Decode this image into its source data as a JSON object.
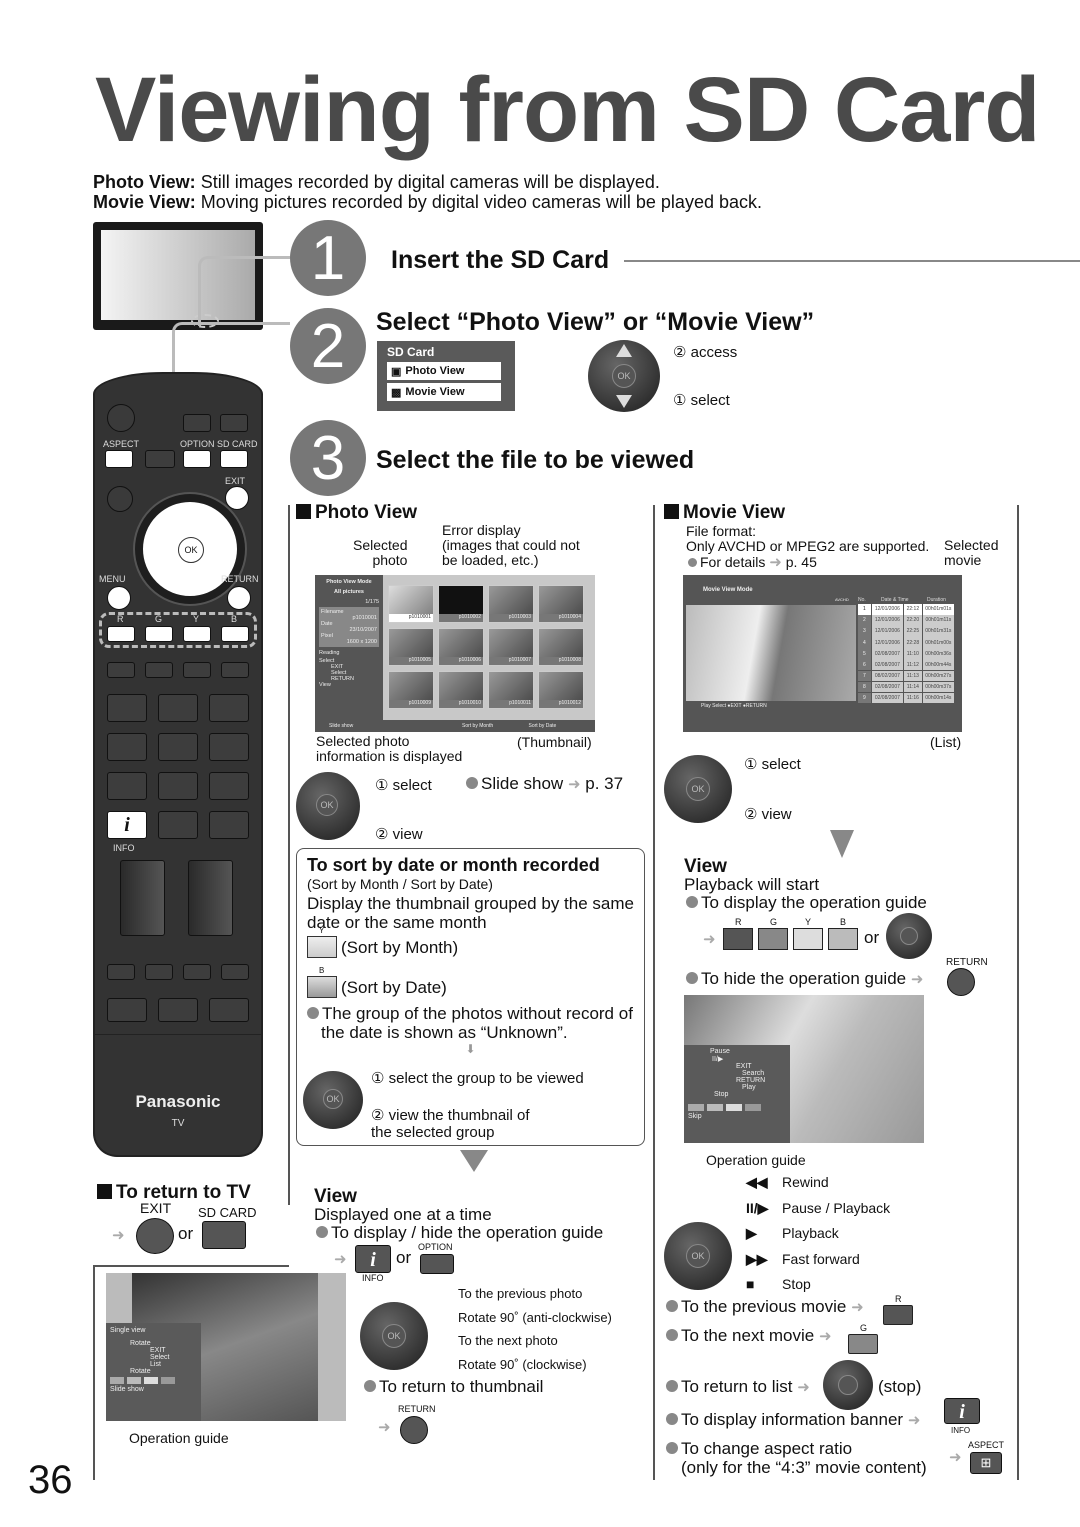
{
  "page": {
    "title": "Viewing from SD Card",
    "page_number": "36",
    "intro": [
      {
        "label": "Photo View:",
        "text": " Still images recorded by digital cameras will be displayed."
      },
      {
        "label": "Movie View:",
        "text": " Moving pictures recorded by digital video cameras will be played back."
      }
    ]
  },
  "steps": [
    {
      "number": "1",
      "title": "Insert the SD Card"
    },
    {
      "number": "2",
      "title": "Select “Photo View” or “Movie View”"
    },
    {
      "number": "3",
      "title": "Select the file to be viewed"
    }
  ],
  "sd_menu": {
    "header": "SD Card",
    "items": [
      {
        "icon": "camera-icon",
        "label": "Photo View"
      },
      {
        "icon": "movie-camera-icon",
        "label": "Movie View"
      }
    ]
  },
  "step2_dpad": {
    "access": "② access",
    "select": "① select",
    "ok": "OK"
  },
  "remote": {
    "aspect": "ASPECT",
    "option": "OPTION",
    "sdcard": "SD CARD",
    "exit": "EXIT",
    "menu": "MENU",
    "return": "RETURN",
    "ok": "OK",
    "color_keys": [
      "R",
      "G",
      "Y",
      "B"
    ],
    "info": "INFO",
    "info_glyph": "i",
    "brand": "Panasonic",
    "brand_sub": "TV"
  },
  "photo_view": {
    "heading": "Photo View",
    "callout_selected": "Selected\nphoto",
    "callout_error": "Error display\n(images that could not\nbe loaded, etc.)",
    "screen": {
      "mode": "Photo View Mode",
      "filter": "All pictures",
      "counter": "1/175",
      "filename_label": "Filename",
      "filename": "p1010001",
      "date_label": "Date",
      "date": "23/10/2007",
      "pixel_label": "Pixel",
      "pixel": "1600 x 1200",
      "reading": "Reading",
      "nav_select": "Select",
      "nav_exit": "EXIT",
      "nav_select2": "Select",
      "nav_return": "RETURN",
      "nav_view": "View",
      "thumbnails": [
        "p1010001",
        "p1010002",
        "p1010003",
        "p1010004",
        "p1010005",
        "p1010006",
        "p1010007",
        "p1010008",
        "p1010009",
        "p1010010",
        "p1010011",
        "p1010012"
      ],
      "footer": [
        "Slide show",
        "",
        "Sort by Month",
        "Sort by Date"
      ]
    },
    "callout_info": "Selected photo\ninformation is displayed",
    "thumbnail_label": "(Thumbnail)",
    "select": "① select",
    "view": "② view",
    "slideshow": "Slide show",
    "slideshow_ref": "p. 37"
  },
  "sort_box": {
    "title": "To sort by date or month recorded",
    "subtitle": "(Sort by Month / Sort by Date)",
    "desc": "Display the thumbnail grouped by the same date or the same month",
    "y_key": "Y",
    "y_label": "(Sort by Month)",
    "b_key": "B",
    "b_label": "(Sort by Date)",
    "note": "The group of the photos without record of the date is shown as “Unknown”.",
    "select": "① select the group to be viewed",
    "view": "② view the thumbnail of\nthe selected group"
  },
  "photo_single": {
    "heading": "View",
    "desc": "Displayed one at a time",
    "toggle_guide": "To display / hide the operation guide",
    "or": "or",
    "info_label": "INFO",
    "option_label": "OPTION",
    "actions": [
      "To the previous photo",
      "Rotate 90˚ (anti-clockwise)",
      "To the next photo",
      "Rotate 90˚ (clockwise)"
    ],
    "return_thumb": "To return to thumbnail",
    "return_label": "RETURN"
  },
  "return_tv": {
    "heading": "To return to TV",
    "exit": "EXIT",
    "sdcard": "SD CARD",
    "or": "or"
  },
  "single_guide": {
    "title": "Single view",
    "rotate_top": "Rotate",
    "exit": "EXIT",
    "select": "Select",
    "list": "List",
    "rotate_bottom": "Rotate",
    "slideshow": "Slide show",
    "caption": "Operation guide"
  },
  "movie_view": {
    "heading": "Movie View",
    "format_label": "File format:",
    "format_text": "Only AVCHD or MPEG2 are supported.",
    "details": "For details",
    "details_ref": "p. 45",
    "selected_movie": "Selected\nmovie",
    "screen": {
      "mode": "Movie View Mode",
      "format_badge": "AVCHD",
      "col_no": "No.",
      "col_datetime": "Date & Time",
      "col_duration": "Duration",
      "rows": [
        {
          "no": "1",
          "date": "12/01/2006",
          "time": "22:12",
          "dur": "00h01m01s"
        },
        {
          "no": "2",
          "date": "12/01/2006",
          "time": "22:20",
          "dur": "00h01m11s"
        },
        {
          "no": "3",
          "date": "12/01/2006",
          "time": "22:25",
          "dur": "00h01m31s"
        },
        {
          "no": "4",
          "date": "12/01/2006",
          "time": "22:28",
          "dur": "00h01m00s"
        },
        {
          "no": "5",
          "date": "02/08/2007",
          "time": "11:10",
          "dur": "00h00m36s"
        },
        {
          "no": "6",
          "date": "02/08/2007",
          "time": "11:12",
          "dur": "00h00m44s"
        },
        {
          "no": "7",
          "date": "08/02/2007",
          "time": "11:13",
          "dur": "00h00m27s"
        },
        {
          "no": "8",
          "date": "02/08/2007",
          "time": "11:14",
          "dur": "00h00m37s"
        },
        {
          "no": "9",
          "date": "02/08/2007",
          "time": "11:16",
          "dur": "00h00m14s"
        }
      ],
      "nav_select": "Select",
      "nav_play": "Play",
      "nav_exit": "EXIT",
      "nav_return": "RETURN"
    },
    "list_label": "(List)",
    "select": "① select",
    "view": "② view"
  },
  "movie_play": {
    "heading": "View",
    "desc": "Playback will start",
    "show_guide": "To display the operation guide",
    "color_keys": [
      "R",
      "G",
      "Y",
      "B"
    ],
    "or": "or",
    "hide_guide": "To hide the operation guide",
    "return_label": "RETURN",
    "guide": {
      "pause": "Pause",
      "pause_glyph": "II/▶",
      "exit": "EXIT",
      "search": "Search",
      "return": "RETURN",
      "play": "Play",
      "stop": "Stop",
      "skip": "Skip"
    },
    "guide_caption": "Operation guide",
    "controls": [
      {
        "glyph": "◀◀",
        "label": "Rewind"
      },
      {
        "glyph": "II/▶",
        "label": "Pause / Playback"
      },
      {
        "glyph": "▶",
        "label": "Playback"
      },
      {
        "glyph": "▶▶",
        "label": "Fast forward"
      },
      {
        "glyph": "■",
        "label": "Stop"
      }
    ],
    "prev_movie": "To the previous movie",
    "prev_key": "R",
    "next_movie": "To the next movie",
    "next_key": "G",
    "return_list": "To return to list",
    "return_list_suffix": "(stop)",
    "info_banner": "To display information banner",
    "info_label": "INFO",
    "aspect_line1": "To change aspect ratio",
    "aspect_line2": "(only for the “4:3” movie content)",
    "aspect_label": "ASPECT"
  }
}
